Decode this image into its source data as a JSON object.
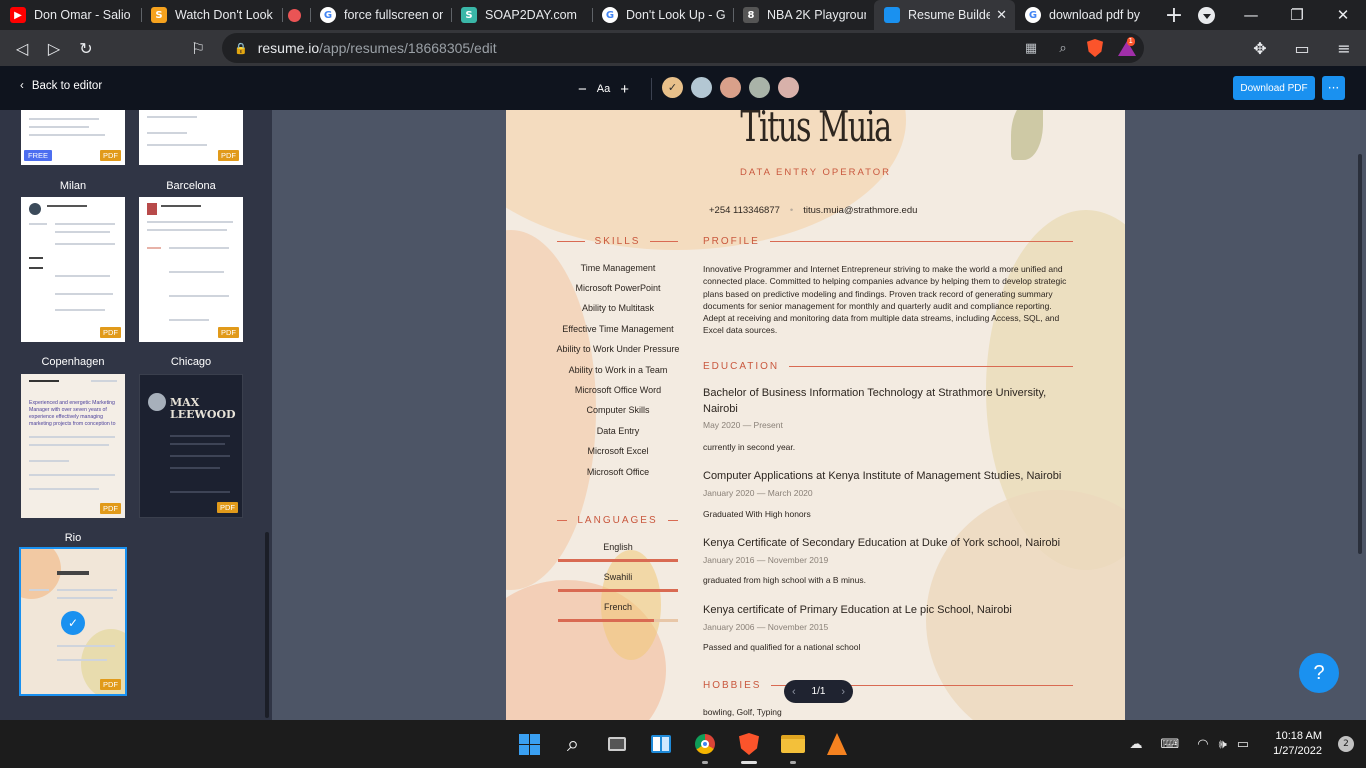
{
  "browser": {
    "tabs": [
      {
        "title": "Don Omar - Salio El",
        "favicon_color": "#ff0000",
        "favicon": "youtube-icon",
        "active": false
      },
      {
        "title": "Watch Don't Look",
        "favicon_color": "#f6a21e",
        "favicon": "s-icon",
        "active": false
      },
      {
        "title": "",
        "favicon_color": "#ea5455",
        "favicon": "red-dot-icon",
        "active": false
      },
      {
        "title": "force fullscreen on",
        "favicon_color": "#ffffff",
        "favicon": "google-icon",
        "active": false
      },
      {
        "title": "SOAP2DAY.com",
        "favicon_color": "#3ab7a8",
        "favicon": "s-icon",
        "active": false
      },
      {
        "title": "Don't Look Up - G",
        "favicon_color": "#ffffff",
        "favicon": "google-icon",
        "active": false
      },
      {
        "title": "NBA 2K Playgroun",
        "favicon_color": "#555555",
        "favicon": "game-icon",
        "active": false
      },
      {
        "title": "Resume Builde",
        "favicon_color": "#1a91f0",
        "favicon": "resume-icon",
        "active": true
      },
      {
        "title": "download pdf by",
        "favicon_color": "#ffffff",
        "favicon": "google-icon",
        "active": false
      }
    ],
    "url_host": "resume.io",
    "url_path": "/app/resumes/18668305/edit",
    "shield_badge": "2",
    "rewards_badge": "1"
  },
  "app": {
    "back_label": "Back to editor",
    "font_minus": "−",
    "font_label": "Aa",
    "font_plus": "+",
    "swatches": [
      "#e8c08a",
      "#b3c7d3",
      "#d9a08a",
      "#a9b3a8",
      "#d8b1aa"
    ],
    "download_label": "Download PDF",
    "more_label": "···"
  },
  "templates": [
    {
      "name": "Milan",
      "badge": "PDF"
    },
    {
      "name": "Barcelona",
      "badge": "PDF"
    },
    {
      "name": "Copenhagen",
      "badge": "PDF",
      "headline": "Experienced and energetic Marketing Manager with over seven years of experience effectively managing marketing projects from conception to completion."
    },
    {
      "name": "Chicago",
      "badge": "PDF",
      "person": "MAX LEEWOOD"
    },
    {
      "name": "Rio",
      "badge": "PDF",
      "selected": true
    }
  ],
  "top_badges": {
    "left_free": "FREE",
    "left_pdf": "PDF",
    "right_pdf": "PDF"
  },
  "resume": {
    "name": "Titus Muia",
    "role": "DATA ENTRY OPERATOR",
    "phone": "+254 113346877",
    "email": "titus.muia@strathmore.edu",
    "sections": {
      "skills": "SKILLS",
      "profile": "PROFILE",
      "education": "EDUCATION",
      "languages": "LANGUAGES",
      "hobbies": "HOBBIES"
    },
    "skills": [
      "Time Management",
      "Microsoft PowerPoint",
      "Ability to Multitask",
      "Effective Time Management",
      "Ability to Work Under Pressure",
      "Ability to Work in a Team",
      "Microsoft Office Word",
      "Computer Skills",
      "Data Entry",
      "Microsoft Excel",
      "Microsoft Office"
    ],
    "languages": [
      {
        "name": "English",
        "level": 1.0
      },
      {
        "name": "Swahili",
        "level": 1.0
      },
      {
        "name": "French",
        "level": 0.8
      }
    ],
    "profile": "Innovative Programmer and Internet Entrepreneur striving to make the world a more unified and connected place. Committed to helping companies advance by helping them to develop strategic plans based on predictive modeling and findings. Proven track record of generating summary documents for senior management for monthly and quarterly audit and compliance reporting. Adept at receiving and monitoring data from multiple data streams, including Access, SQL, and Excel data sources.",
    "education": [
      {
        "title": "Bachelor of Business Information Technology at Strathmore University, Nairobi",
        "dates": "May 2020 — Present",
        "desc": "currently in second year."
      },
      {
        "title": "Computer Applications at Kenya Institute of Management Studies, Nairobi",
        "dates": "January 2020 — March 2020",
        "desc": "Graduated With High honors"
      },
      {
        "title": "Kenya Certificate of Secondary Education at Duke of York school, Nairobi",
        "dates": "January 2016 — November 2019",
        "desc": "graduated from high school with a B minus."
      },
      {
        "title": "Kenya certificate of Primary Education at Le pic School, Nairobi",
        "dates": "January 2006 — November 2015",
        "desc": "Passed and qualified for a national school"
      }
    ],
    "hobbies": "bowling, Golf, Typing",
    "page_indicator": "1/1"
  },
  "help_label": "?",
  "taskbar": {
    "time": "10:18 AM",
    "date": "1/27/2022",
    "notifications": "2"
  }
}
